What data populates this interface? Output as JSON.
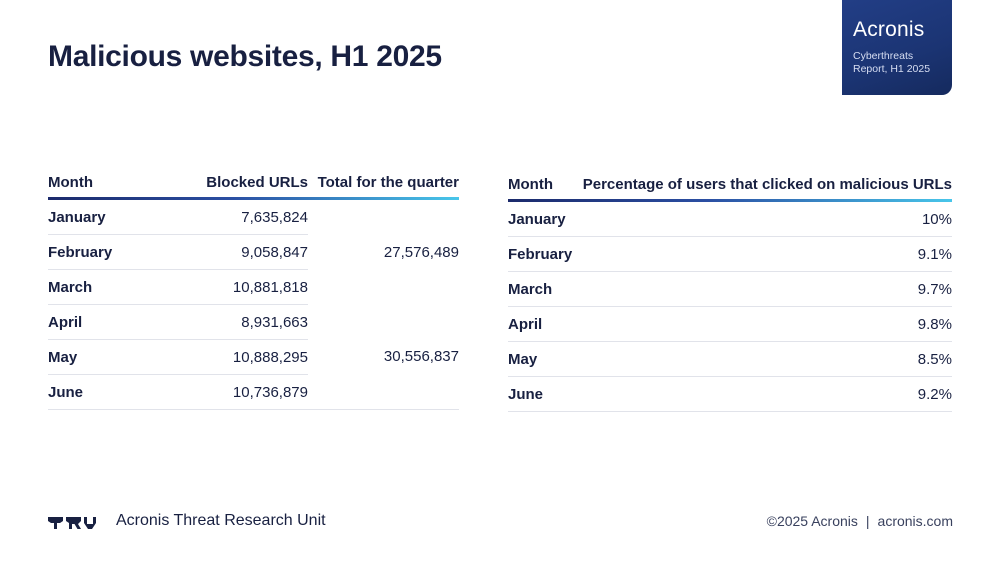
{
  "title": "Malicious websites, H1 2025",
  "badge": {
    "logo": "Acronis",
    "subtitle": "Cyberthreats Report, H1 2025"
  },
  "table_blocked": {
    "headers": {
      "month": "Month",
      "blocked": "Blocked URLs",
      "quarter": "Total for the quarter"
    },
    "rows": [
      {
        "month": "January",
        "blocked": "7,635,824"
      },
      {
        "month": "February",
        "blocked": "9,058,847"
      },
      {
        "month": "March",
        "blocked": "10,881,818"
      },
      {
        "month": "April",
        "blocked": "8,931,663"
      },
      {
        "month": "May",
        "blocked": "10,888,295"
      },
      {
        "month": "June",
        "blocked": "10,736,879"
      }
    ],
    "quarters": [
      "27,576,489",
      "30,556,837"
    ]
  },
  "table_clicks": {
    "headers": {
      "month": "Month",
      "percentage": "Percentage of users that clicked on malicious URLs"
    },
    "rows": [
      {
        "month": "January",
        "percentage": "10%"
      },
      {
        "month": "February",
        "percentage": "9.1%"
      },
      {
        "month": "March",
        "percentage": "9.7%"
      },
      {
        "month": "April",
        "percentage": "9.8%"
      },
      {
        "month": "May",
        "percentage": "8.5%"
      },
      {
        "month": "June",
        "percentage": "9.2%"
      }
    ]
  },
  "footer": {
    "unit_name": "Acronis Threat Research Unit",
    "logo_icon": "tru-logo-icon",
    "copyright": "©2025 Acronis",
    "separator": "|",
    "website": "acronis.com"
  },
  "colors": {
    "navy": "#182041",
    "badge": "#1f3a7d",
    "gradient_start": "#1b2a6b",
    "gradient_end": "#48c6ea"
  }
}
